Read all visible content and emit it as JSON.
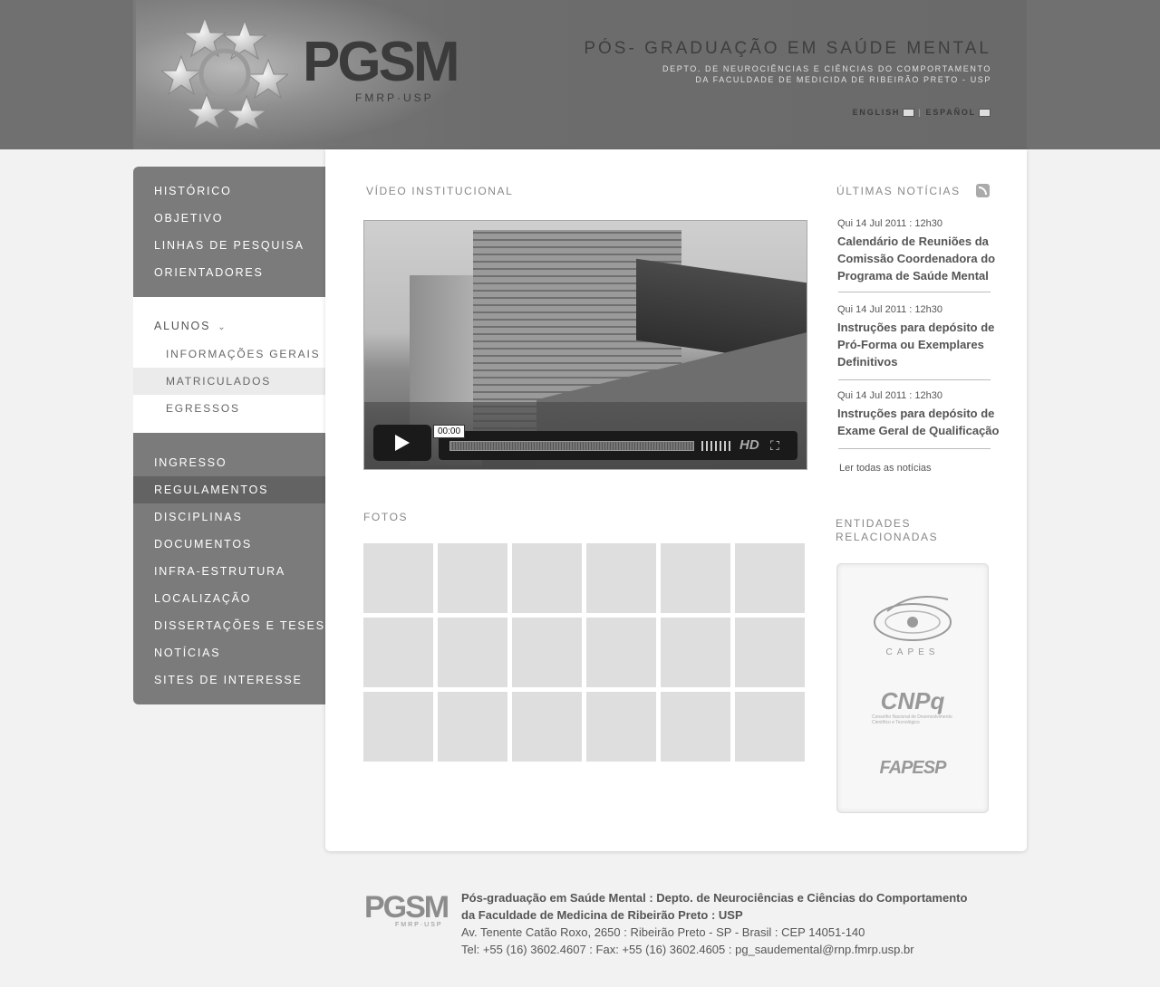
{
  "header": {
    "logo_text": "PGSM",
    "logo_sub": "FMRP·USP",
    "title": "PÓS- GRADUAÇÃO EM SAÚDE MENTAL",
    "subtitle_1": "DEPTO. DE NEUROCIÊNCIAS E CIÊNCIAS DO COMPORTAMENTO",
    "subtitle_2": "DA FACULDADE DE MEDICIDA DE RIBEIRÃO PRETO - USP",
    "lang_en": "ENGLISH",
    "lang_es": "ESPAÑOL",
    "lang_sep": "|"
  },
  "sidebar": {
    "top_items": [
      "HISTÓRICO",
      "OBJETIVO",
      "LINHAS DE PESQUISA",
      "ORIENTADORES"
    ],
    "alunos": {
      "label": "ALUNOS",
      "chevron": "⌄",
      "sub_items": [
        "INFORMAÇÕES GERAIS",
        "MATRICULADOS",
        "EGRESSOS"
      ],
      "active_sub": 1
    },
    "bottom_items": [
      "INGRESSO",
      "REGULAMENTOS",
      "DISCIPLINAS",
      "DOCUMENTOS",
      "INFRA-ESTRUTURA",
      "LOCALIZAÇÃO",
      "DISSERTAÇÕES E TESES",
      "NOTÍCIAS",
      "SITES DE INTERESSE"
    ],
    "active_bottom": 1
  },
  "video": {
    "section_title": "VÍDEO INSTITUCIONAL",
    "time": "00:00",
    "hd_label": "HD",
    "fullscreen_glyph": "⛶",
    "progress": 0
  },
  "photos": {
    "section_title": "FOTOS",
    "count": 18
  },
  "news": {
    "section_title": "ÚLTIMAS NOTÍCIAS",
    "items": [
      {
        "date": "Qui 14 Jul 2011  :  12h30",
        "title": "Calendário de Reuniões da Comissão Coordenadora do Programa de Saúde Mental"
      },
      {
        "date": "Qui 14 Jul 2011  :  12h30",
        "title": "Instruções para depósito de Pró-Forma ou Exemplares Definitivos"
      },
      {
        "date": "Qui 14 Jul 2011  :  12h30",
        "title": "Instruções para depósito de Exame Geral de Qualificação"
      }
    ],
    "read_all": "Ler todas as notícias"
  },
  "entities": {
    "section_title_1": "ENTIDADES",
    "section_title_2": "RELACIONADAS",
    "capes": "CAPES",
    "cnpq": "CNPq",
    "cnpq_sub": "Conselho Nacional de Desenvolvimento Científico e Tecnológico",
    "fapesp": "FAPESP"
  },
  "footer": {
    "logo_text": "PGSM",
    "logo_sub": "FMRP·USP",
    "line1": "Pós-graduação em Saúde Mental  :  Depto. de Neurociências e Ciências do Comportamento",
    "line2": "da Faculdade de Medicina de Ribeirão Preto  :  USP",
    "line3": "Av. Tenente Catão Roxo, 2650  :  Ribeirão Preto - SP - Brasil  :  CEP 14051-140",
    "line4": "Tel: +55 (16) 3602.4607  :  Fax: +55 (16) 3602.4605  :  pg_saudemental@rnp.fmrp.usp.br"
  }
}
